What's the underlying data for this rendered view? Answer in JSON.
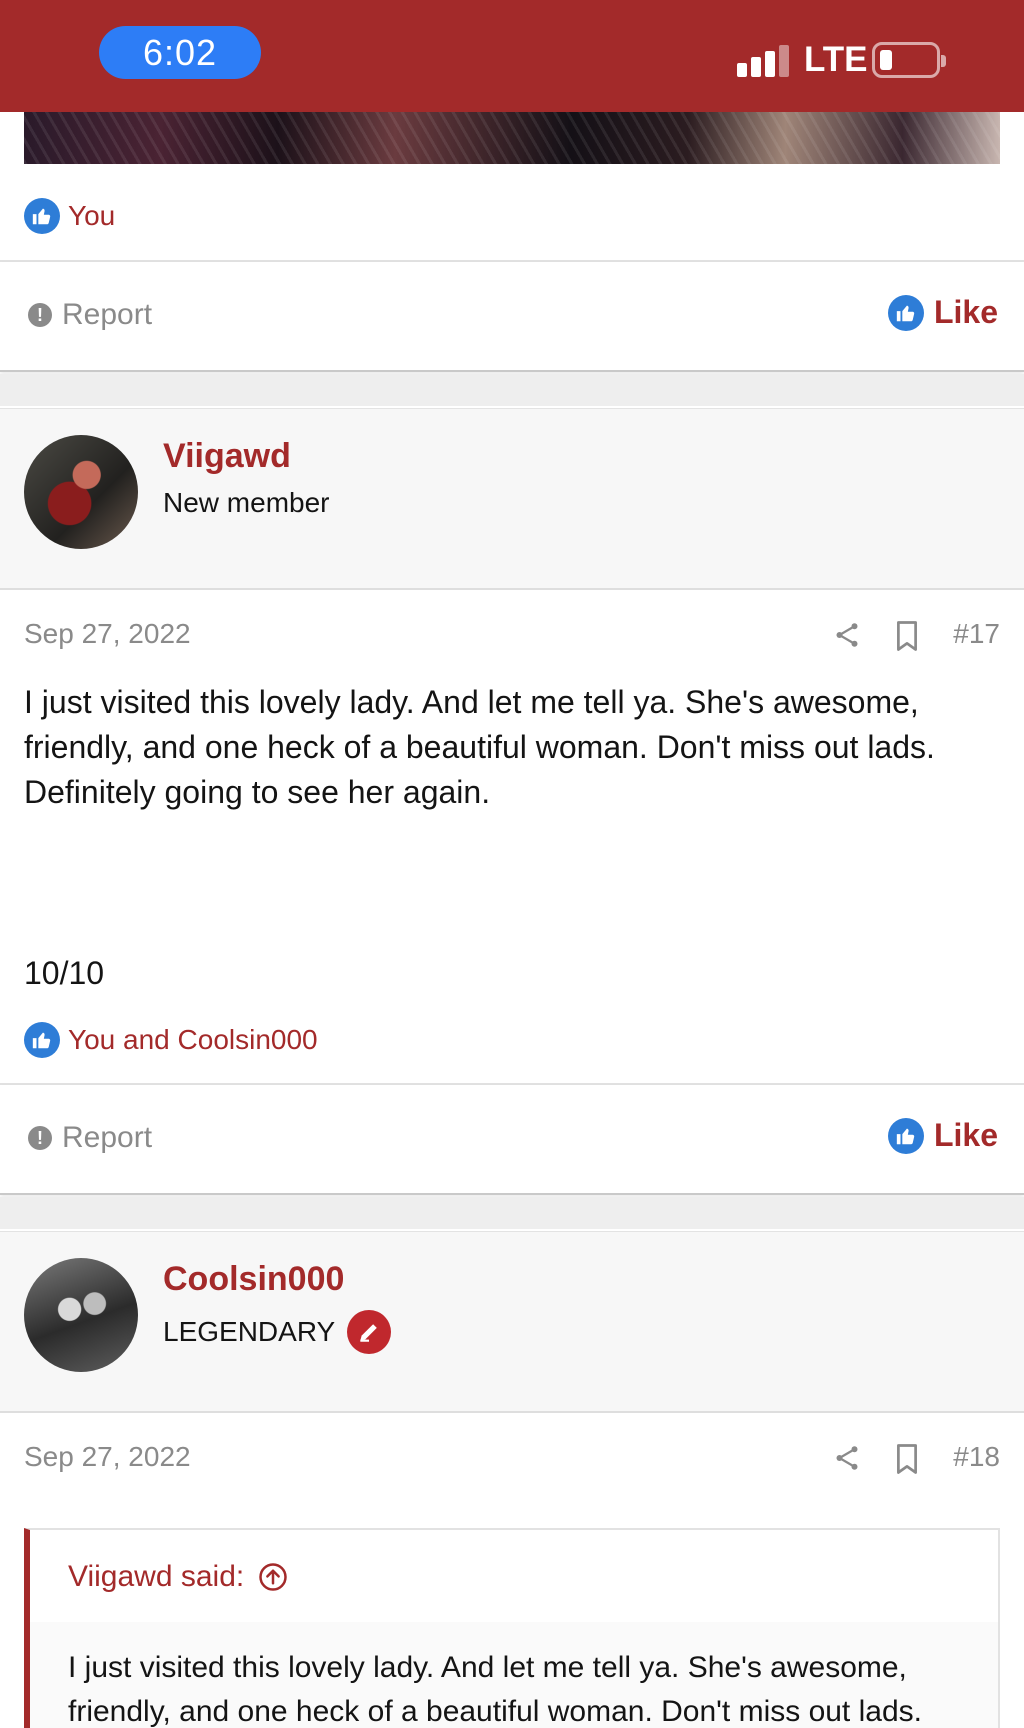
{
  "status_bar": {
    "time": "6:02",
    "network": "LTE",
    "bar_color": "#a32a2a",
    "time_pill_color": "#2d7df6",
    "signal_bars_active": 3,
    "signal_bars_total": 4,
    "battery_level": 0.15
  },
  "post_16": {
    "reaction_text": "You",
    "actions": {
      "report": "Report",
      "like": "Like"
    }
  },
  "post_17": {
    "username": "Viigawd",
    "user_title": "New member",
    "date": "Sep 27, 2022",
    "number": "#17",
    "body": "I just visited this lovely lady. And let me tell ya. She's awesome, friendly, and one heck of a beautiful woman. Don't miss out lads. Definitely going to see her again.",
    "rating": "10/10",
    "reaction_text": "You and Coolsin000",
    "actions": {
      "report": "Report",
      "like": "Like"
    }
  },
  "post_18": {
    "username": "Coolsin000",
    "user_title": "LEGENDARY",
    "date": "Sep 27, 2022",
    "number": "#18",
    "quote": {
      "author": "Viigawd said:",
      "body": "I just visited this lovely lady. And let me tell ya. She's awesome, friendly, and one heck of a beautiful woman. Don't miss out lads."
    }
  },
  "colors": {
    "accent": "#a32a2a",
    "like_blue": "#2e7dd7",
    "muted_text": "#8a8a8a"
  }
}
